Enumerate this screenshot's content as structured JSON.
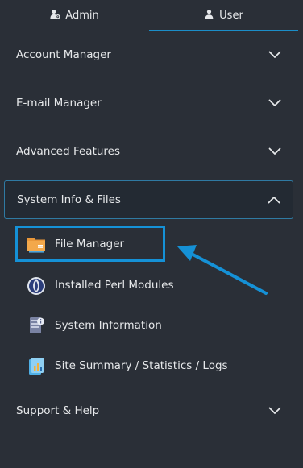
{
  "tabs": [
    {
      "label": "Admin",
      "icon": "admin-user-gear-icon",
      "active": false
    },
    {
      "label": "User",
      "icon": "user-icon",
      "active": true
    }
  ],
  "sections": [
    {
      "label": "Account Manager",
      "state": "collapsed"
    },
    {
      "label": "E-mail Manager",
      "state": "collapsed"
    },
    {
      "label": "Advanced Features",
      "state": "collapsed"
    },
    {
      "label": "System Info & Files",
      "state": "expanded"
    },
    {
      "label": "Support & Help",
      "state": "collapsed"
    }
  ],
  "subitems": [
    {
      "label": "File Manager",
      "icon": "folder-icon",
      "highlighted": true
    },
    {
      "label": "Installed Perl Modules",
      "icon": "perl-onion-icon"
    },
    {
      "label": "System Information",
      "icon": "system-info-icon"
    },
    {
      "label": "Site Summary / Statistics / Logs",
      "icon": "statistics-icon"
    }
  ],
  "colors": {
    "background": "#2a2f37",
    "accent": "#1591d6",
    "open_section_bg": "#232a33",
    "text": "#e6e8ea"
  }
}
